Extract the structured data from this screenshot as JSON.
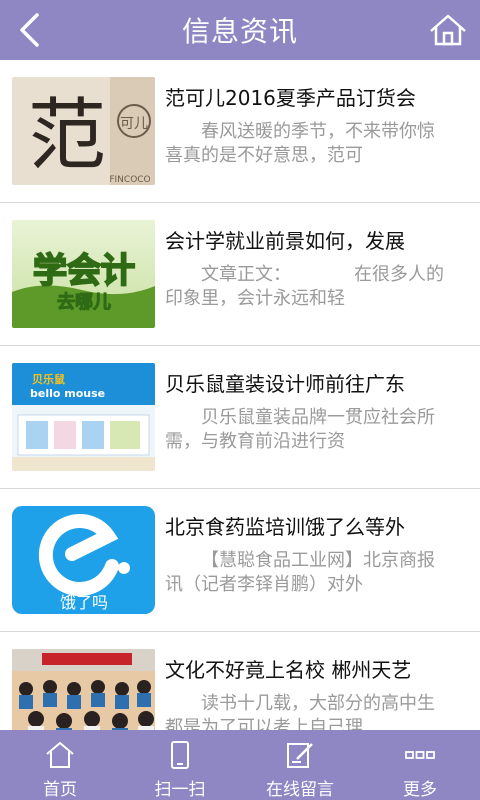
{
  "header": {
    "title": "信息资讯",
    "back_icon": "chevron-left-icon",
    "home_icon": "home-icon"
  },
  "colors": {
    "primary": "#8f86c4",
    "headline_text": "#111111",
    "summary_text": "#9a9a9a",
    "divider": "#d8d8d8"
  },
  "articles": [
    {
      "title": "范可儿2016夏季产品订货会",
      "summary": "春风送暖的季节，不来带你惊喜真的是不好意思，范可",
      "thumb": {
        "main_char": "范",
        "side_text": "可儿",
        "caption": "FINCOCO"
      }
    },
    {
      "title": "会计学就业前景如何，发展",
      "summary": "文章正文：　　　　在很多人的印象里，会计永远和轻",
      "thumb": {
        "main_text": "学会计",
        "sub_text": "去哪儿"
      }
    },
    {
      "title": "贝乐鼠童装设计师前往广东",
      "summary": "贝乐鼠童装品牌一贯应社会所需，与教育前沿进行资",
      "thumb": {
        "brand": "bello mouse",
        "brand_cn": "贝乐鼠"
      }
    },
    {
      "title": "北京食药监培训饿了么等外",
      "summary": "【慧聪食品工业网】北京商报讯（记者李铎肖鹏）对外",
      "thumb": {
        "app_name": "饿了吗"
      }
    },
    {
      "title": "文化不好竟上名校 郴州天艺",
      "summary": "读书十几载，大部分的高中生都是为了可以考上自己理",
      "thumb": {
        "scene": "classroom-photo"
      }
    }
  ],
  "tabbar": [
    {
      "label": "首页",
      "icon": "home-outline-icon"
    },
    {
      "label": "扫一扫",
      "icon": "phone-scan-icon"
    },
    {
      "label": "在线留言",
      "icon": "edit-note-icon"
    },
    {
      "label": "更多",
      "icon": "more-dots-icon"
    }
  ]
}
